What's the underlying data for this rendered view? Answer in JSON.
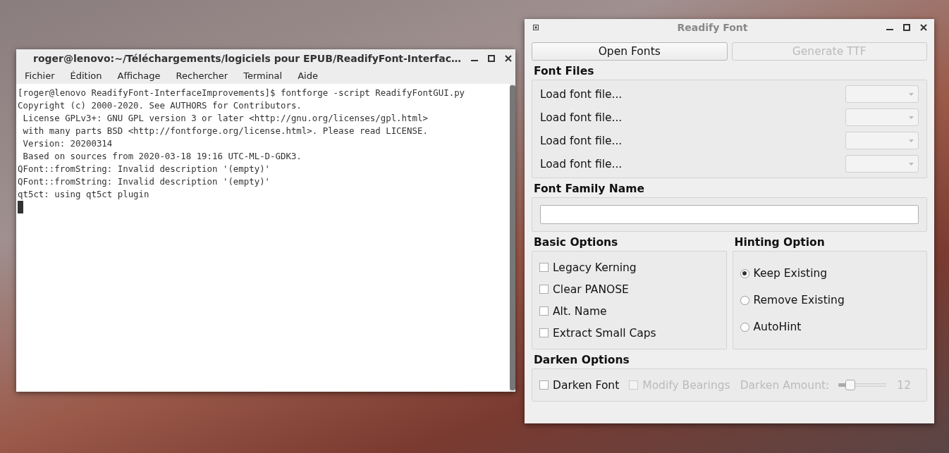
{
  "terminal": {
    "title": "roger@lenovo:~/Téléchargements/logiciels pour EPUB/ReadifyFont-Interfac…",
    "menu": [
      "Fichier",
      "Édition",
      "Affichage",
      "Rechercher",
      "Terminal",
      "Aide"
    ],
    "lines": [
      "[roger@lenovo ReadifyFont-InterfaceImprovements]$ fontforge -script ReadifyFontGUI.py",
      "Copyright (c) 2000-2020. See AUTHORS for Contributors.",
      " License GPLv3+: GNU GPL version 3 or later <http://gnu.org/licenses/gpl.html>",
      " with many parts BSD <http://fontforge.org/license.html>. Please read LICENSE.",
      " Version: 20200314",
      " Based on sources from 2020-03-18 19:16 UTC-ML-D-GDK3.",
      "QFont::fromString: Invalid description '(empty)'",
      "QFont::fromString: Invalid description '(empty)'",
      "qt5ct: using qt5ct plugin"
    ]
  },
  "app": {
    "title": "Readify Font",
    "buttons": [
      {
        "label": "Open Fonts",
        "disabled": false
      },
      {
        "label": "Generate TTF",
        "disabled": true
      }
    ],
    "font_files": {
      "heading": "Font Files",
      "rows": [
        "Load font file...",
        "Load font file...",
        "Load font file...",
        "Load font file..."
      ]
    },
    "family": {
      "heading": "Font Family Name"
    },
    "basic": {
      "heading": "Basic Options",
      "items": [
        {
          "label": "Legacy Kerning",
          "checked": false
        },
        {
          "label": "Clear PANOSE",
          "checked": false
        },
        {
          "label": "Alt. Name",
          "checked": false
        },
        {
          "label": "Extract Small Caps",
          "checked": false
        }
      ]
    },
    "hinting": {
      "heading": "Hinting Option",
      "items": [
        {
          "label": "Keep Existing",
          "selected": true
        },
        {
          "label": "Remove Existing",
          "selected": false
        },
        {
          "label": "AutoHint",
          "selected": false
        }
      ]
    },
    "darken": {
      "heading": "Darken Options",
      "darken_font": {
        "label": "Darken Font",
        "checked": false
      },
      "bearings": {
        "label": "Modify Bearings",
        "checked": false,
        "disabled": true
      },
      "amount": {
        "label": "Darken Amount:",
        "level": 0.25,
        "reading": "12",
        "disabled": true
      }
    }
  }
}
